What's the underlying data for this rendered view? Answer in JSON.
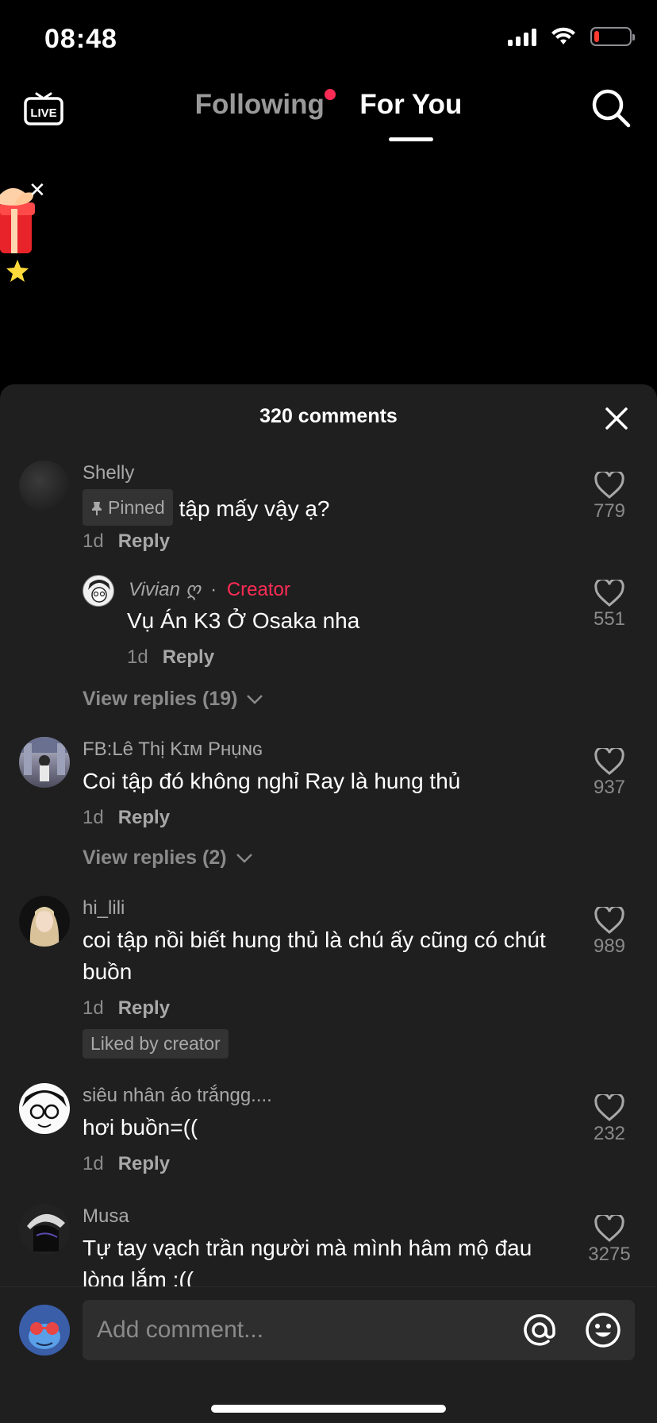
{
  "status_bar": {
    "time": "08:48",
    "battery_level": 0.15
  },
  "nav": {
    "following": "Following",
    "for_you": "For You",
    "live": "LIVE"
  },
  "panel": {
    "comments_count": "320 comments"
  },
  "comments": [
    {
      "username": "Shelly",
      "pinned": "Pinned",
      "text": "tập mấy vậy ạ?",
      "age": "1d",
      "reply": "Reply",
      "likes": "779",
      "creator_reply": {
        "username": "Vivian ღ",
        "separator": "·",
        "creator_label": "Creator",
        "text": "Vụ Án K3 Ở Osaka nha",
        "age": "1d",
        "reply": "Reply",
        "likes": "551"
      },
      "view_replies": "View replies (19)"
    },
    {
      "username": "FB:Lê Thị Kɪᴍ Pʜụɴɢ",
      "text": "Coi tập đó không nghỉ Ray là hung thủ",
      "age": "1d",
      "reply": "Reply",
      "likes": "937",
      "view_replies": "View replies (2)"
    },
    {
      "username": "hi_lili",
      "text": "coi tập nồi biết hung thủ là chú ấy cũng có chút buồn",
      "age": "1d",
      "reply": "Reply",
      "likes": "989",
      "badge": "Liked by creator"
    },
    {
      "username": "siêu nhân áo trắngg....",
      "text": "hơi buồn=((",
      "age": "1d",
      "reply": "Reply",
      "likes": "232"
    },
    {
      "username": "Musa",
      "text": "Tự tay vạch trần người mà mình hâm mộ đau lòng lắm :((",
      "likes": "3275"
    }
  ],
  "input": {
    "placeholder": "Add comment..."
  },
  "colors": {
    "accent": "#fe2c55",
    "panel_bg": "#1f1f1f",
    "muted": "#8a8a8a"
  }
}
